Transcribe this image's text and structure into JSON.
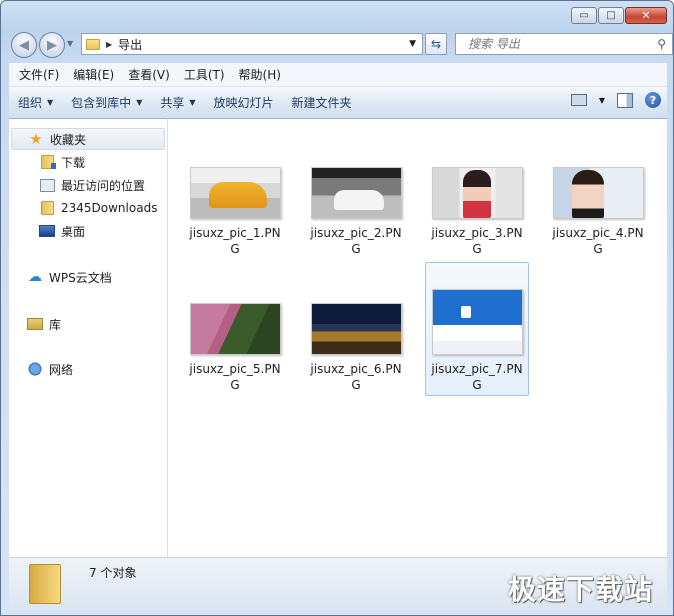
{
  "window_buttons": {
    "minimize": "▭",
    "maximize": "□",
    "close": "✕"
  },
  "address": {
    "path": "导出"
  },
  "search": {
    "placeholder": "搜索 导出"
  },
  "menu": [
    "文件(F)",
    "编辑(E)",
    "查看(V)",
    "工具(T)",
    "帮助(H)"
  ],
  "commands": {
    "organize": "组织",
    "include": "包含到库中",
    "share": "共享",
    "slideshow": "放映幻灯片",
    "new_folder": "新建文件夹"
  },
  "sidebar": {
    "favorites": "收藏夹",
    "downloads": "下载",
    "recent": "最近访问的位置",
    "downloads2345": "2345Downloads",
    "desktop": "桌面",
    "wps": "WPS云文档",
    "library": "库",
    "network": "网络"
  },
  "files": [
    {
      "name": "jisuxz_pic_1.PNG"
    },
    {
      "name": "jisuxz_pic_2.PNG"
    },
    {
      "name": "jisuxz_pic_3.PNG"
    },
    {
      "name": "jisuxz_pic_4.PNG"
    },
    {
      "name": "jisuxz_pic_5.PNG"
    },
    {
      "name": "jisuxz_pic_6.PNG"
    },
    {
      "name": "jisuxz_pic_7.PNG"
    }
  ],
  "status": {
    "count": "7 个对象"
  },
  "watermark": "极速下载站"
}
